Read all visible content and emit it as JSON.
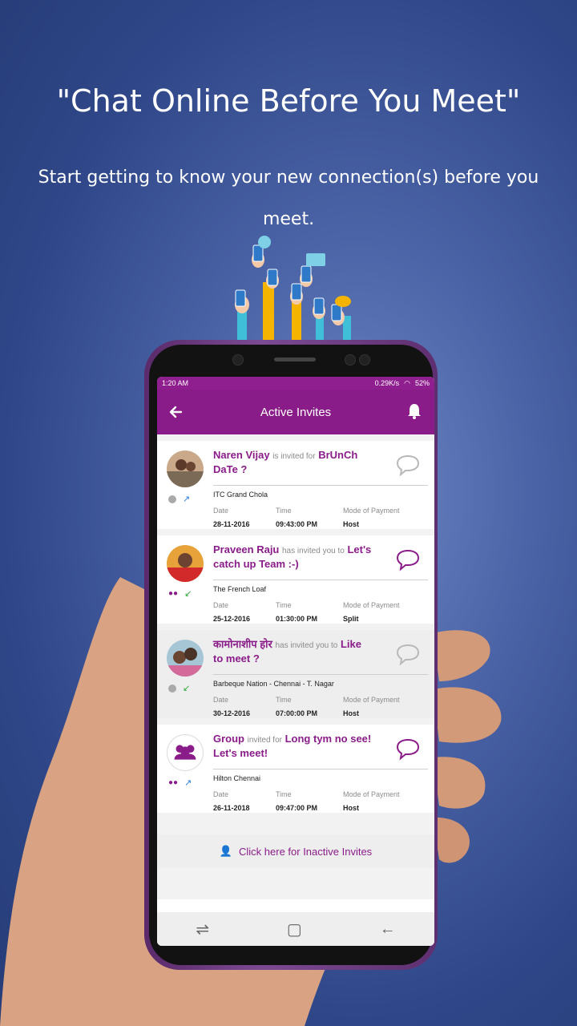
{
  "marketing": {
    "headline": "\"Chat Online Before You Meet\"",
    "subline": "Start getting to know your new connection(s) before you meet."
  },
  "status_bar": {
    "time": "1:20 AM",
    "speed": "0.29K/s",
    "battery": "52%"
  },
  "app_bar": {
    "title": "Active Invites",
    "back_icon": "arrow-left-icon",
    "bell_icon": "bell-icon"
  },
  "invites": [
    {
      "name": "Naren Vijay",
      "connector": "is invited for",
      "event": "BrUnCh DaTe ?",
      "venue": "ITC Grand Chola",
      "date_label": "Date",
      "date": "28-11-2016",
      "time_label": "Time",
      "time": "09:43:00 PM",
      "payment_label": "Mode of Payment",
      "payment": "Host",
      "status_icon": "check-icon",
      "direction_icon": "outgoing-arrow-icon"
    },
    {
      "name": "Praveen Raju",
      "connector": "has invited you to",
      "event": "Let's catch up Team :-)",
      "venue": "The French Loaf",
      "date_label": "Date",
      "date": "25-12-2016",
      "time_label": "Time",
      "time": "01:30:00 PM",
      "payment_label": "Mode of Payment",
      "payment": "Split",
      "status_icon": "group-icon",
      "direction_icon": "incoming-arrow-icon"
    },
    {
      "name": "कामोनाशीप होर",
      "connector": "has invited you to",
      "event": "Like to meet ?",
      "venue": "Barbeque Nation - Chennai - T. Nagar",
      "date_label": "Date",
      "date": "30-12-2016",
      "time_label": "Time",
      "time": "07:00:00 PM",
      "payment_label": "Mode of Payment",
      "payment": "Host",
      "status_icon": "check-icon",
      "direction_icon": "incoming-arrow-icon"
    },
    {
      "name": "Group",
      "connector": "invited for",
      "event": "Long tym no see! Let's meet!",
      "venue": "Hilton Chennai",
      "date_label": "Date",
      "date": "26-11-2018",
      "time_label": "Time",
      "time": "09:47:00 PM",
      "payment_label": "Mode of Payment",
      "payment": "Host",
      "status_icon": "group-icon",
      "direction_icon": "outgoing-arrow-icon"
    }
  ],
  "inactive_link": "Click here for Inactive Invites",
  "colors": {
    "brand": "#8a1c8a",
    "background": "#3a5499"
  }
}
